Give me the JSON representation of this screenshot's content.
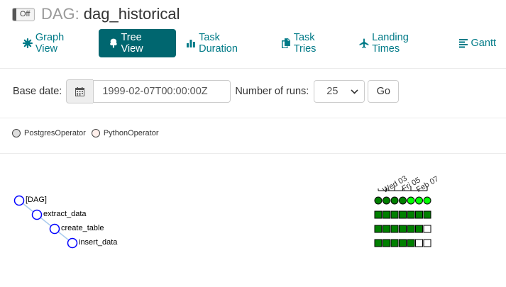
{
  "header": {
    "toggle_label": "Off",
    "dag_prefix": "DAG:",
    "dag_name": "dag_historical"
  },
  "tabs": [
    {
      "label": "Graph View",
      "icon": "asterisk-icon",
      "active": false
    },
    {
      "label": "Tree View",
      "icon": "tree-icon",
      "active": true
    },
    {
      "label": "Task Duration",
      "icon": "bar-chart-icon",
      "active": false
    },
    {
      "label": "Task Tries",
      "icon": "duplicate-icon",
      "active": false
    },
    {
      "label": "Landing Times",
      "icon": "plane-icon",
      "active": false
    },
    {
      "label": "Gantt",
      "icon": "align-left-icon",
      "active": false
    }
  ],
  "form": {
    "base_date_label": "Base date:",
    "base_date_value": "1999-02-07T00:00:00Z",
    "runs_label": "Number of runs:",
    "runs_value": "25",
    "go_label": "Go"
  },
  "legend": [
    {
      "label": "PostgresOperator",
      "color": "#dddddd"
    },
    {
      "label": "PythonOperator",
      "color": "#ffefeb"
    }
  ],
  "tree": {
    "nodes": [
      "[DAG]",
      "extract_data",
      "create_table",
      "insert_data"
    ],
    "date_labels": [
      "Wed 03",
      "Fri 05",
      "Feb 07"
    ],
    "dag_runs": [
      "success",
      "success",
      "success",
      "success",
      "running",
      "running",
      "running"
    ],
    "task_states": [
      [
        "success",
        "success",
        "success",
        "success",
        "success",
        "success",
        "success"
      ],
      [
        "success",
        "success",
        "success",
        "success",
        "success",
        "success",
        "none"
      ],
      [
        "success",
        "success",
        "success",
        "success",
        "success",
        "none",
        "none"
      ]
    ],
    "colors": {
      "success": "#008000",
      "running": "#00ff00",
      "none": "#ffffff",
      "node_stroke": "#0000ff",
      "link": "#aaccee"
    }
  }
}
